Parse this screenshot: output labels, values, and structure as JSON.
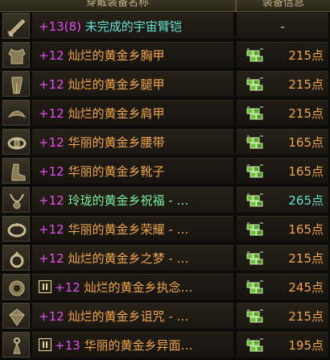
{
  "header": {
    "name_col": "穿戴装备名称",
    "info_col": "装备信息"
  },
  "rows": [
    {
      "icon": "sword-icon",
      "plus": "+13",
      "extra": "(8)",
      "name": "未完成的宇宙臂铠",
      "name_color": "cyan",
      "set_icon": false,
      "points": "-",
      "points_color": "neutral"
    },
    {
      "icon": "chest-armor-icon",
      "plus": "+12",
      "extra": "",
      "name": "灿烂的黄金乡胸甲",
      "name_color": "orange",
      "set_icon": true,
      "points": "215点",
      "points_color": "orange"
    },
    {
      "icon": "leg-armor-icon",
      "plus": "+12",
      "extra": "",
      "name": "灿烂的黄金乡腿甲",
      "name_color": "orange",
      "set_icon": true,
      "points": "215点",
      "points_color": "orange"
    },
    {
      "icon": "shoulder-armor-icon",
      "plus": "+12",
      "extra": "",
      "name": "灿烂的黄金乡肩甲",
      "name_color": "orange",
      "set_icon": true,
      "points": "215点",
      "points_color": "orange"
    },
    {
      "icon": "belt-icon",
      "plus": "+12",
      "extra": "",
      "name": "华丽的黄金乡腰带",
      "name_color": "orange",
      "set_icon": true,
      "points": "165点",
      "points_color": "orange"
    },
    {
      "icon": "boots-icon",
      "plus": "+12",
      "extra": "",
      "name": "华丽的黄金乡靴子",
      "name_color": "orange",
      "set_icon": true,
      "points": "165点",
      "points_color": "orange"
    },
    {
      "icon": "necklace-icon",
      "plus": "+12",
      "extra": "",
      "name": "玲珑的黄金乡祝福 - …",
      "name_color": "green",
      "set_icon": true,
      "points": "265点",
      "points_color": "cyan"
    },
    {
      "icon": "bracelet-icon",
      "plus": "+12",
      "extra": "",
      "name": "华丽的黄金乡荣耀 - …",
      "name_color": "orange",
      "set_icon": true,
      "points": "165点",
      "points_color": "orange"
    },
    {
      "icon": "ring-icon",
      "plus": "+12",
      "extra": "",
      "name": "灿烂的黄金乡之梦 - …",
      "name_color": "orange",
      "set_icon": true,
      "points": "215点",
      "points_color": "orange"
    },
    {
      "icon": "support-icon",
      "plus": "+12",
      "extra": "",
      "name": "灿烂的黄金乡执念…",
      "name_color": "orange",
      "set_icon": true,
      "points": "245点",
      "points_color": "orange",
      "badge": true
    },
    {
      "icon": "gem-icon",
      "plus": "+12",
      "extra": "",
      "name": "灿烂的黄金乡诅咒 - …",
      "name_color": "orange",
      "set_icon": true,
      "points": "215点",
      "points_color": "orange"
    },
    {
      "icon": "earring-icon",
      "plus": "+13",
      "extra": "",
      "name": "华丽的黄金乡异面…",
      "name_color": "orange",
      "set_icon": true,
      "points": "195点",
      "points_color": "orange",
      "badge": true
    }
  ],
  "colors": {
    "orange": "#f2a64b",
    "cyan": "#65e1d6",
    "green": "#7cf0a0",
    "plus": "#e64bf2"
  }
}
